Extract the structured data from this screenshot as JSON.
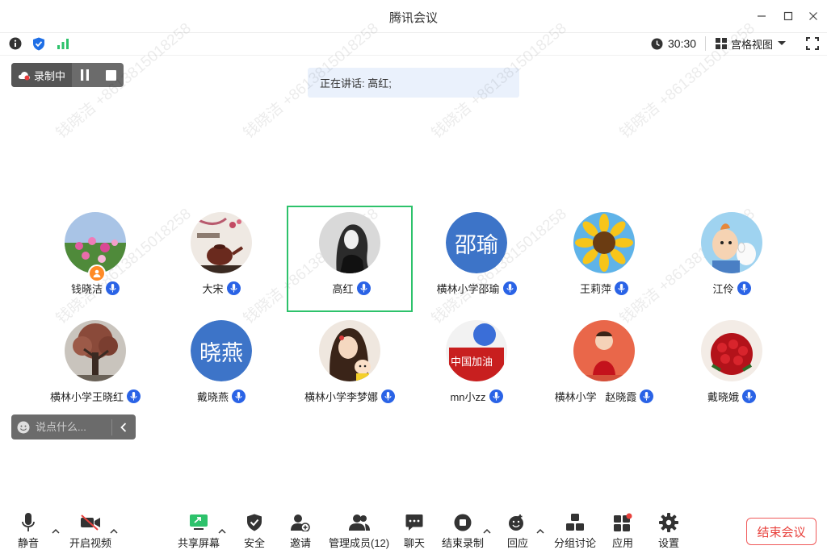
{
  "window": {
    "title": "腾讯会议"
  },
  "status": {
    "timer": "30:30",
    "view_label": "宫格视图"
  },
  "recording": {
    "label": "录制中"
  },
  "speaking": {
    "text": "正在讲话: 高红;"
  },
  "watermark": {
    "text": "钱晓洁 +8613815018258"
  },
  "participants": [
    {
      "name": "钱晓洁",
      "avatar": "flower-field-photo",
      "host": true,
      "active": false
    },
    {
      "name": "大宋",
      "avatar": "teapot-photo",
      "host": false,
      "active": false
    },
    {
      "name": "高红",
      "avatar": "portrait-sketch-photo",
      "host": false,
      "active": true
    },
    {
      "name": "横林小学邵瑜",
      "avatar_text": "邵瑜",
      "host": false,
      "active": false
    },
    {
      "name": "王莉萍",
      "avatar": "sunflower-photo",
      "host": false,
      "active": false
    },
    {
      "name": "江伶",
      "avatar": "cartoon-tintin-photo",
      "host": false,
      "active": false
    },
    {
      "name": "横林小学王晓红",
      "avatar": "tree-photo",
      "host": false,
      "active": false
    },
    {
      "name": "戴晓燕",
      "avatar_text": "晓燕",
      "host": false,
      "active": false
    },
    {
      "name": "横林小学李梦娜",
      "avatar": "cartoon-girl-photo",
      "host": false,
      "active": false
    },
    {
      "name": "mn小zz",
      "avatar": "china-cheer-photo",
      "host": false,
      "active": false
    },
    {
      "name": "横林小学   赵晓霞",
      "avatar": "baby-photo",
      "host": false,
      "active": false
    },
    {
      "name": "戴晓娥",
      "avatar": "roses-photo",
      "host": false,
      "active": false
    }
  ],
  "chat": {
    "placeholder": "说点什么..."
  },
  "toolbar": {
    "mute": "静音",
    "video": "开启视频",
    "share": "共享屏幕",
    "security": "安全",
    "invite": "邀请",
    "members": "管理成员(12)",
    "chat": "聊天",
    "end_record": "结束录制",
    "feedback": "回应",
    "breakout": "分组讨论",
    "apps": "应用",
    "settings": "设置",
    "end_meeting": "结束会议"
  },
  "colors": {
    "accent": "#2a63e6",
    "active_border": "#2dc26b",
    "end_red": "#e8413c",
    "host_badge": "#ff8a25",
    "avatar_blue": "#3d74c8"
  }
}
